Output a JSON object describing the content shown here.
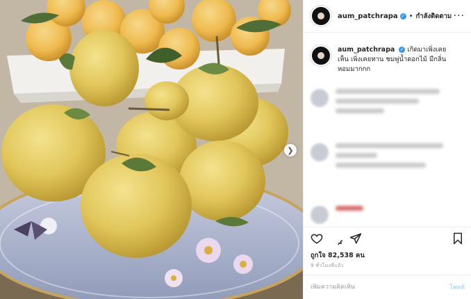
{
  "colors": {
    "accent": "#3897f0",
    "post_button_disabled": "#b2dffc",
    "fruit": "#e2c55a",
    "leaf": "#5b7a3a"
  },
  "header": {
    "username": "aum_patchrapa",
    "follow_label": "กำลังติดตาม",
    "verified_icon": "verified-badge-icon",
    "more_icon": "more-options-icon"
  },
  "caption": {
    "username": "aum_patchrapa",
    "text": "เกิดมาเพิ่งเคยเห็น เพิ่งเคยทาน ชมพู่น้ำดอกไม้ มีกลิ่นหอมมากกก"
  },
  "post": {
    "likes_text": "ถูกใจ 82,538 คน",
    "time_text": "9 ชั่วโมงที่แล้ว",
    "comment_placeholder": "เพิ่มความคิดเห็น",
    "post_label": "โพสต์"
  },
  "icons": {
    "like": "heart-icon",
    "comment": "comment-icon",
    "share": "share-icon",
    "save": "bookmark-icon",
    "next": "chevron-right-icon"
  }
}
